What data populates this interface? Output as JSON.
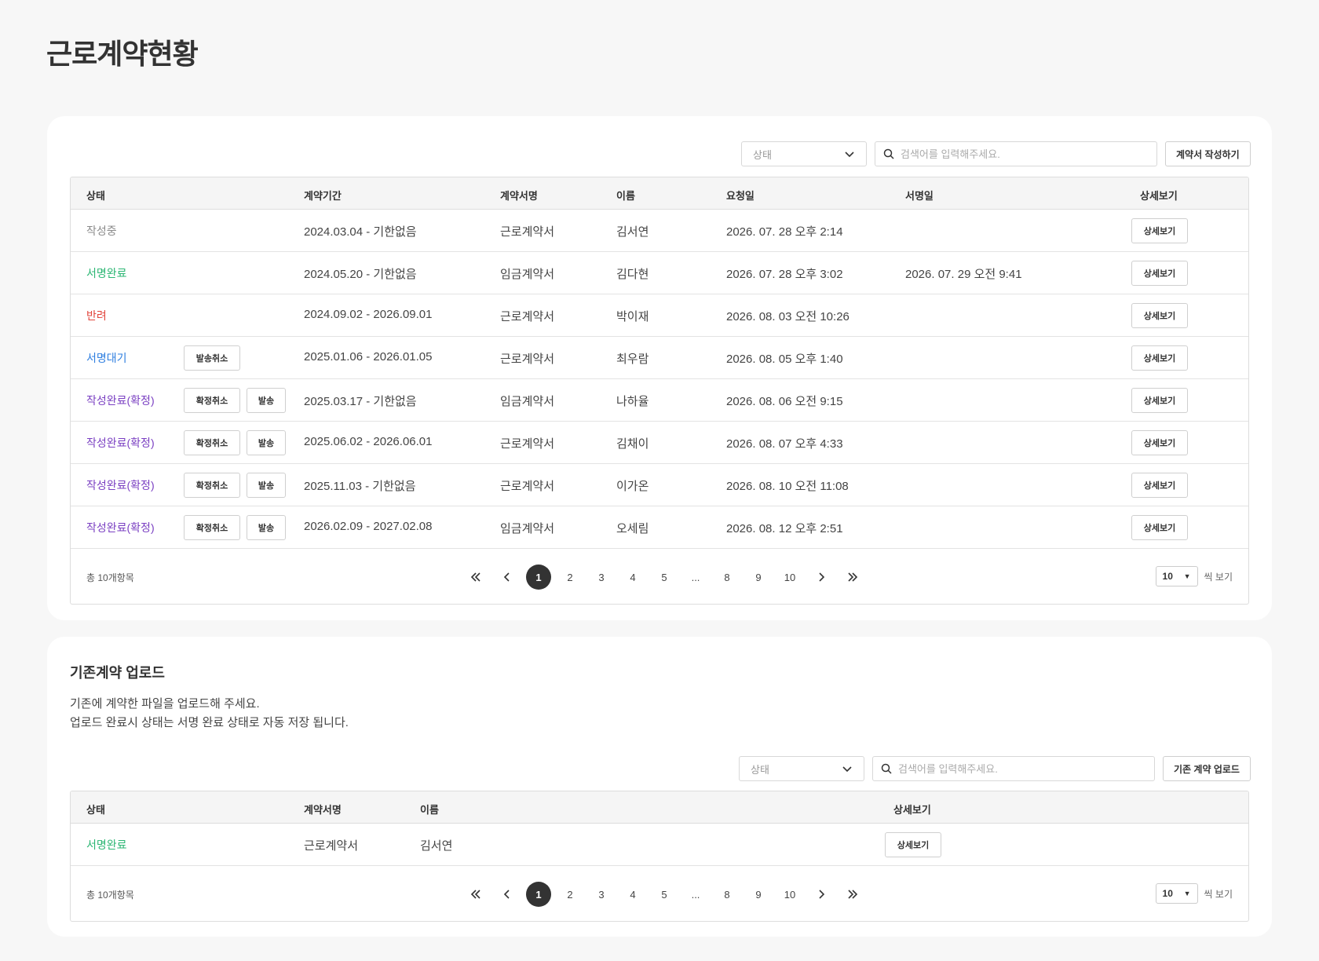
{
  "page": {
    "title": "근로계약현황"
  },
  "contracts": {
    "filter": {
      "placeholder": "상태"
    },
    "search": {
      "placeholder": "검색어를 입력해주세요."
    },
    "create_button": "계약서 작성하기",
    "columns": [
      "상태",
      "계약기간",
      "계약서명",
      "이름",
      "요청일",
      "서명일",
      "상세보기"
    ],
    "rows": [
      {
        "status": "작성중",
        "period": "2024.03.04 - 기한없음",
        "doc": "근로계약서",
        "name": "김서연",
        "requested": "2026. 07. 28 오후 2:14",
        "signed": "",
        "detail": "상세보기"
      },
      {
        "status": "서명완료",
        "period": "2024.05.20 - 기한없음",
        "doc": "임금계약서",
        "name": "김다현",
        "requested": "2026. 07. 28 오후 3:02",
        "signed": "2026. 07. 29 오전 9:41",
        "detail": "상세보기"
      },
      {
        "status": "반려",
        "period": "2024.09.02 - 2026.09.01",
        "doc": "근로계약서",
        "name": "박이재",
        "requested": "2026. 08. 03 오전 10:26",
        "signed": "",
        "detail": "상세보기"
      },
      {
        "status": "서명대기",
        "action1": "발송취소",
        "period": "2025.01.06 - 2026.01.05",
        "doc": "근로계약서",
        "name": "최우람",
        "requested": "2026. 08. 05 오후 1:40",
        "signed": "",
        "detail": "상세보기"
      },
      {
        "status": "작성완료(확정)",
        "action1": "확정취소",
        "action2": "발송",
        "period": "2025.03.17 - 기한없음",
        "doc": "임금계약서",
        "name": "나하율",
        "requested": "2026. 08. 06 오전 9:15",
        "signed": "",
        "detail": "상세보기"
      },
      {
        "status": "작성완료(확정)",
        "action1": "확정취소",
        "action2": "발송",
        "period": "2025.06.02 - 2026.06.01",
        "doc": "근로계약서",
        "name": "김채이",
        "requested": "2026. 08. 07 오후 4:33",
        "signed": "",
        "detail": "상세보기"
      },
      {
        "status": "작성완료(확정)",
        "action1": "확정취소",
        "action2": "발송",
        "period": "2025.11.03 - 기한없음",
        "doc": "근로계약서",
        "name": "이가온",
        "requested": "2026. 08. 10 오전 11:08",
        "signed": "",
        "detail": "상세보기"
      },
      {
        "status": "작성완료(확정)",
        "action1": "확정취소",
        "action2": "발송",
        "period": "2026.02.09 - 2027.02.08",
        "doc": "임금계약서",
        "name": "오세림",
        "requested": "2026. 08. 12 오후 2:51",
        "signed": "",
        "detail": "상세보기"
      }
    ],
    "footer": {
      "total": "총 10개항목",
      "pages": [
        "1",
        "2",
        "3",
        "4",
        "5",
        "...",
        "8",
        "9",
        "10"
      ],
      "current_page": "1",
      "per_page": "10",
      "per_page_label": "씩 보기"
    }
  },
  "upload": {
    "title": "기존계약 업로드",
    "desc_line1": "기존에 계약한 파일을 업로드해 주세요.",
    "desc_line2": "업로드 완료시 상태는 서명 완료 상태로 자동 저장 됩니다.",
    "filter": {
      "placeholder": "상태"
    },
    "search": {
      "placeholder": "검색어를 입력해주세요."
    },
    "upload_button": "기존 계약 업로드",
    "columns": [
      "상태",
      "계약서명",
      "이름",
      "상세보기"
    ],
    "rows": [
      {
        "status": "서명완료",
        "doc": "근로계약서",
        "name": "김서연",
        "detail": "상세보기"
      }
    ],
    "footer": {
      "total": "총 10개항목",
      "pages": [
        "1",
        "2",
        "3",
        "4",
        "5",
        "...",
        "8",
        "9",
        "10"
      ],
      "current_page": "1",
      "per_page": "10",
      "per_page_label": "씩 보기"
    }
  },
  "status_colors": {
    "작성중": "#8a8a8a",
    "서명완료": "#2bb673",
    "반려": "#e2453c",
    "서명대기": "#2f7fe0",
    "작성완료(확정)": "#7a3fc2"
  },
  "icons": [
    "chevron-down-icon",
    "search-icon",
    "double-chevron-left-icon",
    "chevron-left-icon",
    "chevron-right-icon",
    "double-chevron-right-icon",
    "caret-down-icon"
  ]
}
